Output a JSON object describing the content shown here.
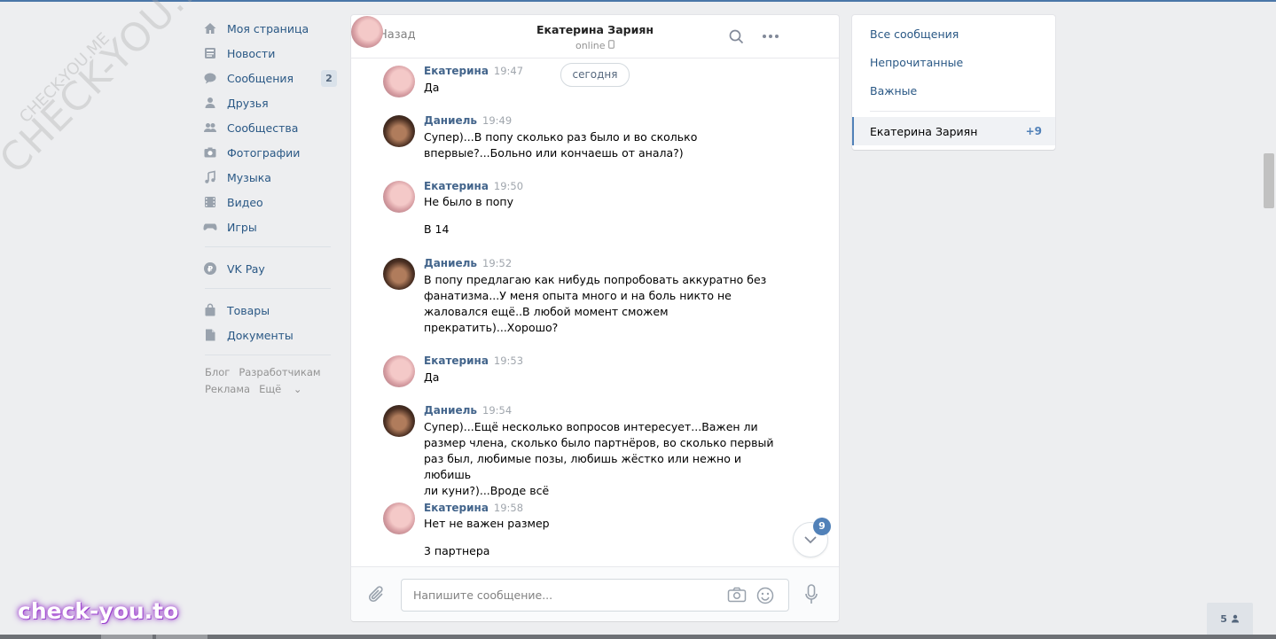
{
  "nav": {
    "items": [
      {
        "label": "Моя страница",
        "icon": "home-icon"
      },
      {
        "label": "Новости",
        "icon": "news-icon"
      },
      {
        "label": "Сообщения",
        "icon": "messages-icon",
        "badge": "2"
      },
      {
        "label": "Друзья",
        "icon": "friends-icon"
      },
      {
        "label": "Сообщества",
        "icon": "communities-icon"
      },
      {
        "label": "Фотографии",
        "icon": "camera-icon"
      },
      {
        "label": "Музыка",
        "icon": "music-icon"
      },
      {
        "label": "Видео",
        "icon": "video-icon"
      },
      {
        "label": "Игры",
        "icon": "games-icon"
      }
    ],
    "pay": {
      "label": "VK Pay",
      "icon": "vkpay-icon"
    },
    "extra": [
      {
        "label": "Товары",
        "icon": "bag-icon"
      },
      {
        "label": "Документы",
        "icon": "document-icon"
      }
    ],
    "footer": {
      "blog": "Блог",
      "dev": "Разработчикам",
      "ads": "Реклама",
      "more": "Ещё"
    }
  },
  "chat": {
    "back_label": "Назад",
    "peer_name": "Екатерина Зариян",
    "peer_status": "online",
    "date_pill": "сегодня",
    "unread_count": "9",
    "messages": [
      {
        "author": "Екатерина",
        "time": "19:47",
        "who": "kat",
        "text": "Да"
      },
      {
        "author": "Даниель",
        "time": "19:49",
        "who": "dan",
        "text": "Супер)...В попу сколько раз было и во сколько\nвпервые?...Больно или кончаешь от анала?)"
      },
      {
        "author": "Екатерина",
        "time": "19:50",
        "who": "kat",
        "text": "Не было в попу\n\nВ 14"
      },
      {
        "author": "Даниель",
        "time": "19:52",
        "who": "dan",
        "text": "В попу предлагаю как нибудь попробовать аккуратно без\nфанатизма...У меня опыта много и на боль никто не\nжаловался ещё..В любой момент сможем\nпрекратить)...Хорошо?"
      },
      {
        "author": "Екатерина",
        "time": "19:53",
        "who": "kat",
        "text": "Да"
      },
      {
        "author": "Даниель",
        "time": "19:54",
        "who": "dan",
        "text": "Супер)...Ещё несколько вопросов интересует...Важен ли\nразмер члена, сколько было партнёров, во сколько первый\nраз был, любимые позы, любишь жёстко или нежно и любишь\nли куни?)...Вроде всё"
      },
      {
        "author": "Екатерина",
        "time": "19:58",
        "who": "kat",
        "text": "Нет не важен размер\n\n3 партнера"
      }
    ],
    "composer_placeholder": "Напишите сообщение..."
  },
  "right_panel": {
    "all": "Все сообщения",
    "unread": "Непрочитанные",
    "important": "Важные",
    "conv_name": "Екатерина Зариян",
    "conv_count": "+9"
  },
  "watermark": {
    "big": "CHECK-YOU.ME",
    "small": "CHECK-YOU.ME",
    "brand": "check-you.to"
  },
  "friends_online": "5",
  "colors": {
    "accent": "#5181b8",
    "link": "#2a5885",
    "background": "#edeef0"
  }
}
